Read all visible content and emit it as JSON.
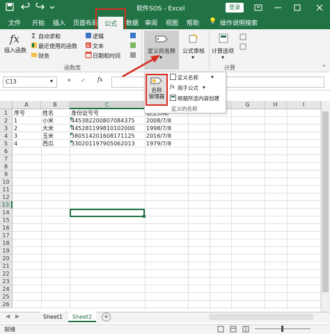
{
  "title_bar": {
    "title": "软件SOS  -  Excel",
    "login": "登录"
  },
  "tabs": [
    "文件",
    "开始",
    "插入",
    "页面布局",
    "公式",
    "数据",
    "审阅",
    "视图",
    "帮助",
    "操作说明搜索"
  ],
  "active_tab": "公式",
  "ribbon": {
    "insert_function": {
      "line1": "插入函数"
    },
    "autosum": "自动求和",
    "recent": "最近使用的函数",
    "financial": "财务",
    "logical": "逻辑",
    "text": "文本",
    "datetime": "日期和时间",
    "group_label": "函数库",
    "defined_names": "定义的名称",
    "formula_audit": "公式审核",
    "calc_options": "计算选项",
    "calc_group": "计算"
  },
  "formula_bar": {
    "name_box": "C13",
    "fx": "fx"
  },
  "columns": [
    "A",
    "B",
    "C",
    "D",
    "E",
    "F",
    "G",
    "H",
    "I"
  ],
  "rows": [
    "1",
    "2",
    "3",
    "4",
    "5",
    "6",
    "7",
    "8",
    "9",
    "10",
    "11",
    "12",
    "13",
    "14",
    "15",
    "16",
    "17",
    "18",
    "19",
    "20",
    "21",
    "22",
    "23",
    "24",
    "25",
    "26"
  ],
  "table": [
    [
      "序号",
      "姓名",
      "身份证号号",
      "出生日期"
    ],
    [
      "1",
      "小米",
      "445382200807084375",
      "2008/7/8"
    ],
    [
      "2",
      "大米",
      "445281199810102000",
      "1998/7/8"
    ],
    [
      "3",
      "玉米",
      "380514201608171125",
      "2016/7/8"
    ],
    [
      "4",
      "西瓜",
      "330201197905062013",
      "1979/7/8"
    ]
  ],
  "popup": {
    "manager": "名称\n管理器",
    "manager_l1": "名称",
    "manager_l2": "管理器",
    "define_name": "定义名称",
    "use_in_formula": "用于公式",
    "create_from_selection": "根据所选内容创建",
    "group_label": "定义的名称"
  },
  "sheets": [
    "Sheet1",
    "Sheet2"
  ],
  "active_sheet": "Sheet2",
  "status": "就绪",
  "colors": {
    "accent": "#217346",
    "highlight": "#d62d20"
  }
}
